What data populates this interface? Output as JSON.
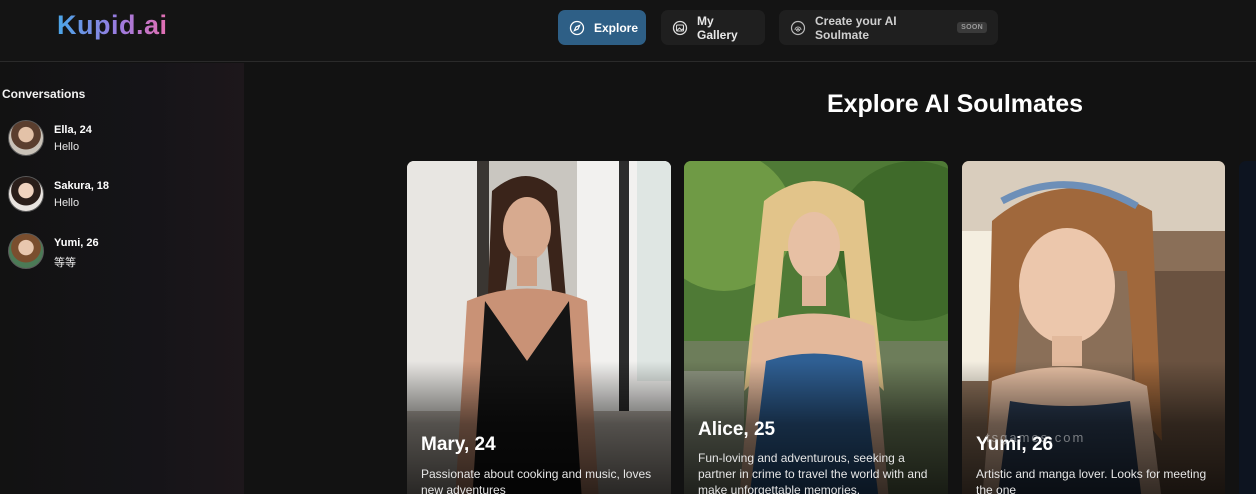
{
  "app": {
    "logo": "Kupid.ai"
  },
  "nav": {
    "explore": "Explore",
    "gallery": "My Gallery",
    "create": "Create your AI Soulmate",
    "soon_badge": "SOON",
    "active_color": "#2e5f86"
  },
  "sidebar": {
    "title": "Conversations",
    "conversations": [
      {
        "name": "Ella, 24",
        "message": "Hello"
      },
      {
        "name": "Sakura, 18",
        "message": "Hello"
      },
      {
        "name": "Yumi, 26",
        "message": "等等"
      }
    ]
  },
  "main": {
    "heading": "Explore AI Soulmates",
    "cards": [
      {
        "name": "Mary, 24",
        "description": "Passionate about cooking and music, loves new adventures"
      },
      {
        "name": "Alice, 25",
        "description": "Fun-loving and adventurous, seeking a partner in crime to travel the world with and make unforgettable memories."
      },
      {
        "name": "Yumi, 26",
        "description": "Artistic and manga lover. Looks for meeting the one"
      }
    ],
    "watermark": "tsgames.com"
  }
}
